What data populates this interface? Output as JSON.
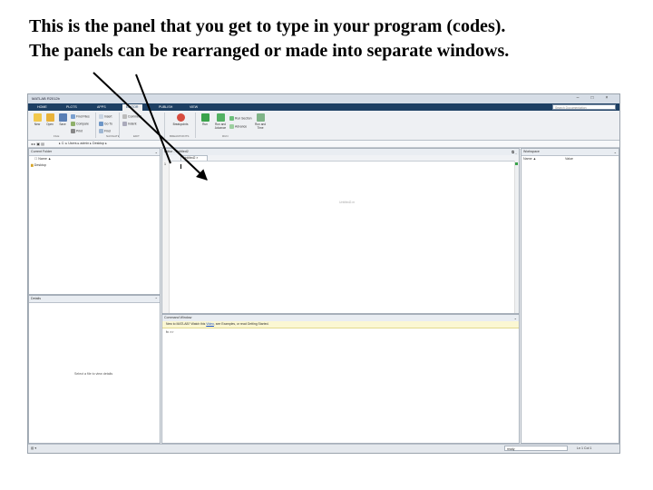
{
  "caption": {
    "line1": "This is the panel that you get to type in your program (codes).",
    "line2": "The panels can be rearranged or made into separate windows."
  },
  "window": {
    "title": "MATLAB R2012b",
    "controls": {
      "minimize": "‒",
      "maximize": "□",
      "close": "×"
    }
  },
  "ribbon": {
    "tabs": [
      "HOME",
      "PLOTS",
      "APPS",
      "EDITOR",
      "PUBLISH",
      "VIEW"
    ],
    "active_tab": 3,
    "search_placeholder": "Search Documentation",
    "buttons": {
      "new": "New",
      "open": "Open",
      "save": "Save",
      "find_files": "Find Files",
      "compare": "Compare",
      "print": "Print",
      "go_to": "Go To",
      "find": "Find",
      "insert": "Insert",
      "comment": "Comment",
      "indent": "Indent",
      "breakpoints": "Breakpoints",
      "run": "Run",
      "run_and_advance": "Run and Advance",
      "run_section": "Run Section",
      "advance": "Advance",
      "run_and_time": "Run and Time"
    },
    "groups": {
      "file": "FILE",
      "edit": "EDIT",
      "navigate": "NAVIGATE",
      "breakpoints": "BREAKPOINTS",
      "run": "RUN"
    }
  },
  "address": {
    "nav": "◂ ▸ ▣ ▤",
    "path": "▸ C: ▸ Users ▸ admin ▸ Desktop ▸"
  },
  "current_folder": {
    "title": "Current Folder",
    "column": "Name ▲",
    "items": [
      "Desktop"
    ]
  },
  "details": {
    "title": "Details",
    "empty": "Select a file to view details"
  },
  "editor": {
    "title": "Editor - Untitled2",
    "tab": "Untitled2",
    "line_number": "1",
    "watermark": "Untitled2.m"
  },
  "command_window": {
    "title": "Command Window",
    "notice_text": "New to MATLAB? Watch this ",
    "notice_link": "Video",
    "notice_tail": ", see Examples, or read Getting Started.",
    "prompt": "fx >>"
  },
  "workspace": {
    "title": "Workspace",
    "col_name": "Name ▲",
    "col_value": "Value"
  },
  "status": {
    "left": "▥ ▾",
    "zoom": "ready",
    "right": "Ln 1   Col 1"
  },
  "colors": {
    "ribbon_bar": "#1d3f63",
    "notice_bg": "#fbf7d3",
    "link": "#1a4fc5",
    "arrow": "#000000"
  }
}
